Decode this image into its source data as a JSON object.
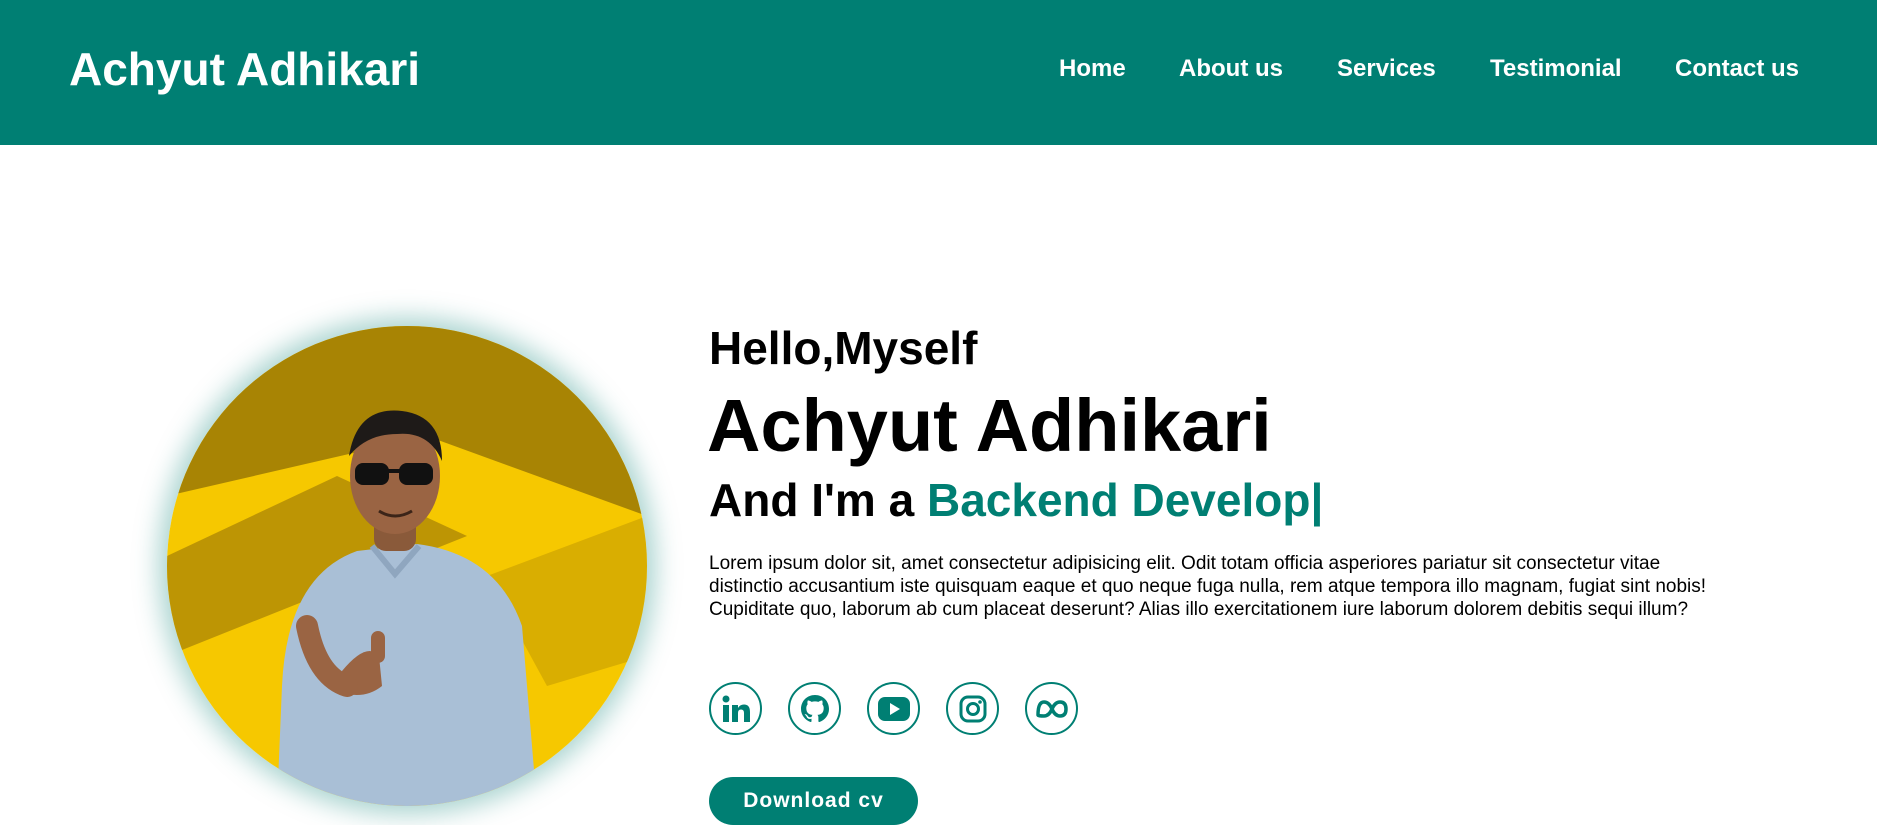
{
  "header": {
    "logo": "Achyut Adhikari",
    "nav": [
      "Home",
      "About us",
      "Services",
      "Testimonial",
      "Contact us"
    ]
  },
  "hero": {
    "greeting": "Hello,Myself",
    "name": "Achyut Adhikari",
    "role_prefix": "And I'm a ",
    "role_typed": "Backend Develop|",
    "bio": "Lorem ipsum dolor sit, amet consectetur adipisicing elit. Odit totam officia asperiores pariatur sit consectetur vitae distinctio accusantium iste quisquam eaque et quo neque fuga nulla, rem atque tempora illo magnam, fugiat sint nobis! Cupiditate quo, laborum ab cum placeat deserunt? Alias illo exercitationem iure laborum dolorem debitis sequi illum?",
    "socials": [
      "linkedin-icon",
      "github-icon",
      "youtube-icon",
      "instagram-icon",
      "meta-icon"
    ],
    "cv_button": "Download cv"
  },
  "colors": {
    "primary": "#007f73",
    "text": "#000000",
    "background": "#ffffff",
    "photo_bg": "#ffd000"
  }
}
